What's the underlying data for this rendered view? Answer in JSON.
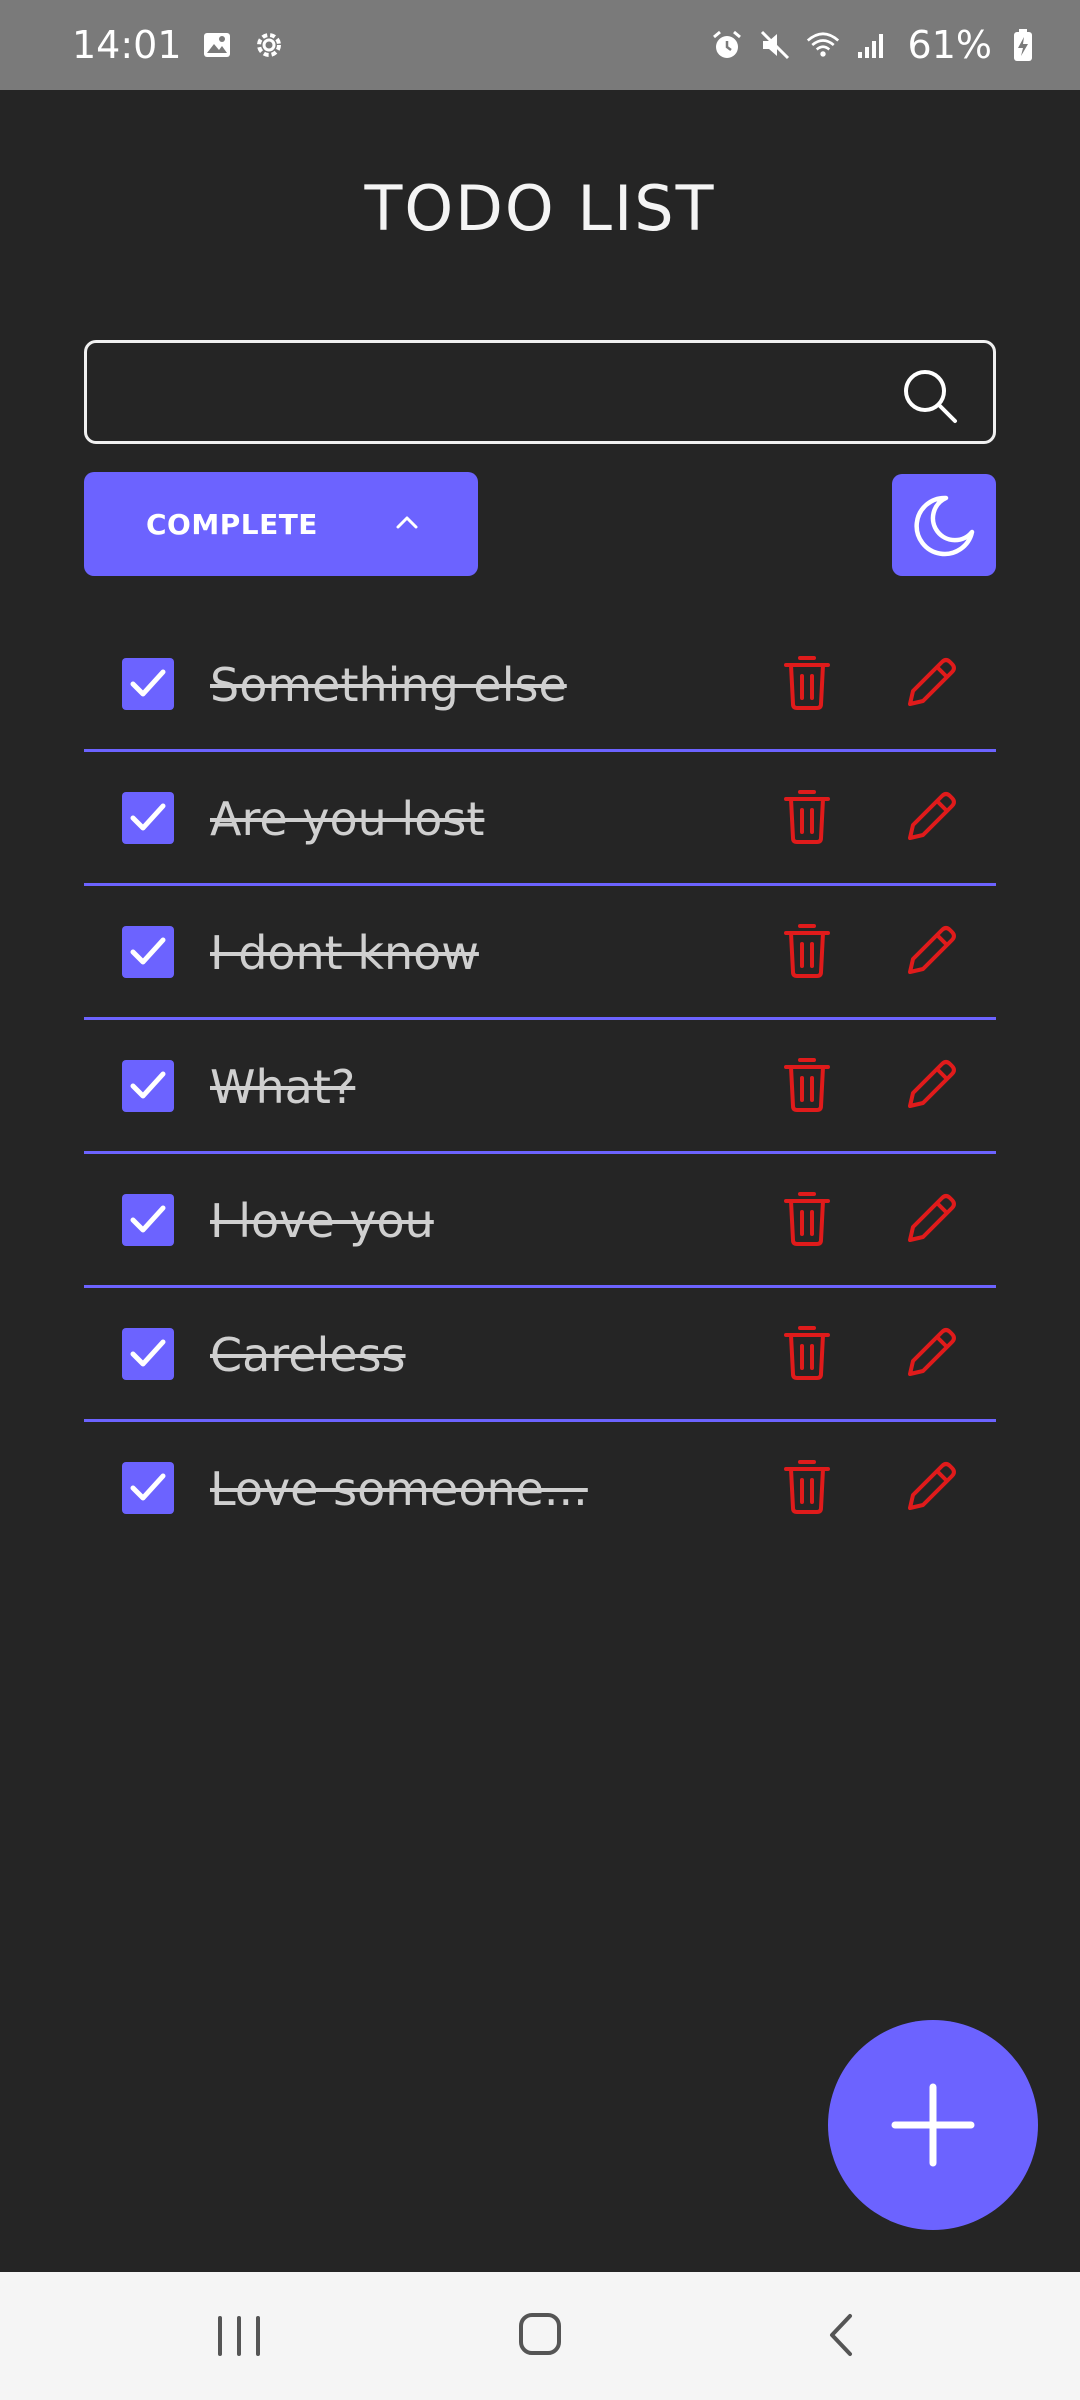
{
  "status_bar": {
    "time": "14:01",
    "battery": "61%",
    "icons": [
      "image-icon",
      "settings-gear-icon",
      "alarm-icon",
      "mute-icon",
      "wifi-icon",
      "signal-icon",
      "battery-charging-icon"
    ]
  },
  "header": {
    "title": "TODO LIST"
  },
  "search": {
    "value": "",
    "placeholder": "",
    "icon": "search-icon"
  },
  "filter": {
    "label": "COMPLETE",
    "icon": "chevron-up-icon"
  },
  "theme_toggle": {
    "icon": "moon-icon",
    "mode": "dark"
  },
  "todos": [
    {
      "text": "Something else",
      "done": true
    },
    {
      "text": "Are you lost",
      "done": true
    },
    {
      "text": "I dont know",
      "done": true
    },
    {
      "text": "What?",
      "done": true
    },
    {
      "text": "I love you",
      "done": true
    },
    {
      "text": "Careless",
      "done": true
    },
    {
      "text": "Love someone...",
      "done": true
    }
  ],
  "fab": {
    "icon": "plus-icon"
  },
  "nav": {
    "icons": [
      "recent-apps-icon",
      "home-icon",
      "back-icon"
    ]
  },
  "colors": {
    "background": "#252525",
    "accent": "#6c63ff",
    "danger": "#e01b1b",
    "status_bar": "#7a7a7a",
    "nav_bar": "#f5f5f5"
  }
}
